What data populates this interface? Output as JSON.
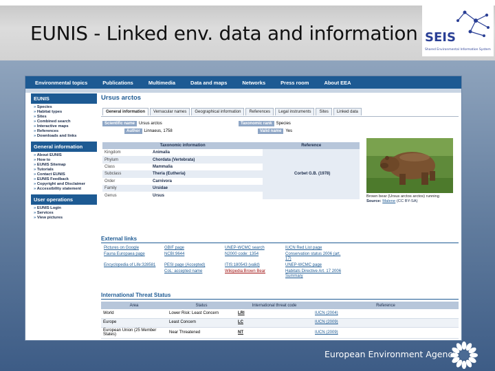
{
  "slide": {
    "title": "EUNIS - Linked env. data and information",
    "seis_logo_text": "SEIS",
    "seis_logo_sub": "Shared Environmental Information System",
    "footer_org": "European Environment Agency"
  },
  "colors": {
    "nav_blue": "#1d5a93",
    "band_top": "#8fa4bd",
    "band_bottom": "#3d5c86"
  },
  "topnav": [
    "Environmental topics",
    "Publications",
    "Multimedia",
    "Data and maps",
    "Networks",
    "Press room",
    "About EEA"
  ],
  "sidebar": [
    {
      "heading": "EUNIS",
      "items": [
        "Species",
        "Habitat types",
        "Sites",
        "Combined search",
        "Interactive maps",
        "References",
        "Downloads and links"
      ]
    },
    {
      "heading": "General information",
      "items": [
        "About EUNIS",
        "How to",
        "EUNIS Sitemap",
        "Tutorials",
        "Contact EUNIS",
        "EUNIS Feedback",
        "Copyright and Disclaimer",
        "Accessibility statement"
      ]
    },
    {
      "heading": "User operations",
      "items": [
        "EUNIS Login",
        "Services",
        "View pictures"
      ]
    }
  ],
  "species": {
    "title": "Ursus arctos",
    "tabs": [
      "General information",
      "Vernacular names",
      "Geographical information",
      "References",
      "Legal instruments",
      "Sites",
      "Linked data"
    ],
    "active_tab": "General information",
    "scientific_name_label": "Scientific name",
    "scientific_name": "Ursus arctos",
    "author_label": "Author",
    "author": "Linnaeus, 1758",
    "taxonomic_rank_label": "Taxonomic rank",
    "taxonomic_rank": "Species",
    "valid_name_label": "Valid name",
    "valid_name": "Yes"
  },
  "taxonomy": {
    "header_info": "Taxonomic information",
    "header_ref": "Reference",
    "reference": "Corbet G.B. (1978)",
    "rows": [
      {
        "rank": "Kingdom",
        "value": "Animalia"
      },
      {
        "rank": "Phylum",
        "value": "Chordata (Vertebrata)"
      },
      {
        "rank": "Class",
        "value": "Mammalia"
      },
      {
        "rank": "Subclass",
        "value": "Theria (Eutheria)"
      },
      {
        "rank": "Order",
        "value": "Carnivora"
      },
      {
        "rank": "Family",
        "value": "Ursidae"
      },
      {
        "rank": "Genus",
        "value": "Ursus"
      }
    ]
  },
  "photo": {
    "caption": "Brown bear (Ursus arctos arctos) running",
    "source_label": "Source:",
    "source_author": "Malene",
    "license": "(CC BY-SA)"
  },
  "external_links": {
    "heading": "External links",
    "rows": [
      [
        "Pictures on Google",
        "GBIF page",
        "UNEP-WCMC search",
        "IUCN Red List page"
      ],
      [
        "Fauna Europaea page",
        "NCBI:9644",
        "N2000 code: 1354",
        "Conservation status 2006 (art. 17)"
      ],
      [
        "Encyclopedia of Life:328581",
        "PESI page (Accepted)",
        "ITIS:180543 (valid)",
        "UNEP-WCMC page"
      ],
      [
        "",
        "CoL: accepted name",
        "Wikipedia:Brown Bear",
        "Habitats Directive Art. 17 2006 Summary"
      ]
    ]
  },
  "threat": {
    "heading": "International Threat Status",
    "columns": [
      "Area",
      "Status",
      "International threat code",
      "Reference"
    ],
    "rows": [
      {
        "area": "World",
        "status": "Lower Risk: Least Concern",
        "code": "LRl",
        "reference": "IUCN (2004)"
      },
      {
        "area": "Europe",
        "status": "Least Concern",
        "code": "LC",
        "reference": "IUCN (2009)"
      },
      {
        "area": "European Union (25 Member States)",
        "status": "Near Threatened",
        "code": "NT",
        "reference": "IUCN (2009)"
      }
    ]
  }
}
